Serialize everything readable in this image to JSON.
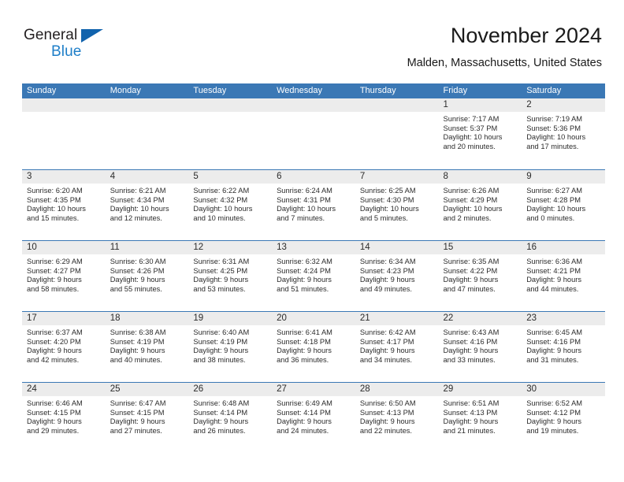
{
  "brand": {
    "word1": "General",
    "word2": "Blue",
    "flag_icon": "triangle-flag-icon",
    "color_dark": "#231f20",
    "color_blue": "#1e7ec8"
  },
  "header": {
    "title": "November 2024",
    "subtitle": "Malden, Massachusetts, United States"
  },
  "theme": {
    "header_blue": "#3b78b5",
    "daynum_band": "#ececec",
    "text": "#2b2b2b"
  },
  "calendar": {
    "day_headers": [
      "Sunday",
      "Monday",
      "Tuesday",
      "Wednesday",
      "Thursday",
      "Friday",
      "Saturday"
    ],
    "labels": {
      "sunrise": "Sunrise:",
      "sunset": "Sunset:",
      "daylight": "Daylight:"
    },
    "weeks": [
      [
        {
          "empty": true
        },
        {
          "empty": true
        },
        {
          "empty": true
        },
        {
          "empty": true
        },
        {
          "empty": true
        },
        {
          "day": "1",
          "sunrise": "Sunrise: 7:17 AM",
          "sunset": "Sunset: 5:37 PM",
          "daylight_line1": "Daylight: 10 hours",
          "daylight_line2": "and 20 minutes."
        },
        {
          "day": "2",
          "sunrise": "Sunrise: 7:19 AM",
          "sunset": "Sunset: 5:36 PM",
          "daylight_line1": "Daylight: 10 hours",
          "daylight_line2": "and 17 minutes."
        }
      ],
      [
        {
          "day": "3",
          "sunrise": "Sunrise: 6:20 AM",
          "sunset": "Sunset: 4:35 PM",
          "daylight_line1": "Daylight: 10 hours",
          "daylight_line2": "and 15 minutes."
        },
        {
          "day": "4",
          "sunrise": "Sunrise: 6:21 AM",
          "sunset": "Sunset: 4:34 PM",
          "daylight_line1": "Daylight: 10 hours",
          "daylight_line2": "and 12 minutes."
        },
        {
          "day": "5",
          "sunrise": "Sunrise: 6:22 AM",
          "sunset": "Sunset: 4:32 PM",
          "daylight_line1": "Daylight: 10 hours",
          "daylight_line2": "and 10 minutes."
        },
        {
          "day": "6",
          "sunrise": "Sunrise: 6:24 AM",
          "sunset": "Sunset: 4:31 PM",
          "daylight_line1": "Daylight: 10 hours",
          "daylight_line2": "and 7 minutes."
        },
        {
          "day": "7",
          "sunrise": "Sunrise: 6:25 AM",
          "sunset": "Sunset: 4:30 PM",
          "daylight_line1": "Daylight: 10 hours",
          "daylight_line2": "and 5 minutes."
        },
        {
          "day": "8",
          "sunrise": "Sunrise: 6:26 AM",
          "sunset": "Sunset: 4:29 PM",
          "daylight_line1": "Daylight: 10 hours",
          "daylight_line2": "and 2 minutes."
        },
        {
          "day": "9",
          "sunrise": "Sunrise: 6:27 AM",
          "sunset": "Sunset: 4:28 PM",
          "daylight_line1": "Daylight: 10 hours",
          "daylight_line2": "and 0 minutes."
        }
      ],
      [
        {
          "day": "10",
          "sunrise": "Sunrise: 6:29 AM",
          "sunset": "Sunset: 4:27 PM",
          "daylight_line1": "Daylight: 9 hours",
          "daylight_line2": "and 58 minutes."
        },
        {
          "day": "11",
          "sunrise": "Sunrise: 6:30 AM",
          "sunset": "Sunset: 4:26 PM",
          "daylight_line1": "Daylight: 9 hours",
          "daylight_line2": "and 55 minutes."
        },
        {
          "day": "12",
          "sunrise": "Sunrise: 6:31 AM",
          "sunset": "Sunset: 4:25 PM",
          "daylight_line1": "Daylight: 9 hours",
          "daylight_line2": "and 53 minutes."
        },
        {
          "day": "13",
          "sunrise": "Sunrise: 6:32 AM",
          "sunset": "Sunset: 4:24 PM",
          "daylight_line1": "Daylight: 9 hours",
          "daylight_line2": "and 51 minutes."
        },
        {
          "day": "14",
          "sunrise": "Sunrise: 6:34 AM",
          "sunset": "Sunset: 4:23 PM",
          "daylight_line1": "Daylight: 9 hours",
          "daylight_line2": "and 49 minutes."
        },
        {
          "day": "15",
          "sunrise": "Sunrise: 6:35 AM",
          "sunset": "Sunset: 4:22 PM",
          "daylight_line1": "Daylight: 9 hours",
          "daylight_line2": "and 47 minutes."
        },
        {
          "day": "16",
          "sunrise": "Sunrise: 6:36 AM",
          "sunset": "Sunset: 4:21 PM",
          "daylight_line1": "Daylight: 9 hours",
          "daylight_line2": "and 44 minutes."
        }
      ],
      [
        {
          "day": "17",
          "sunrise": "Sunrise: 6:37 AM",
          "sunset": "Sunset: 4:20 PM",
          "daylight_line1": "Daylight: 9 hours",
          "daylight_line2": "and 42 minutes."
        },
        {
          "day": "18",
          "sunrise": "Sunrise: 6:38 AM",
          "sunset": "Sunset: 4:19 PM",
          "daylight_line1": "Daylight: 9 hours",
          "daylight_line2": "and 40 minutes."
        },
        {
          "day": "19",
          "sunrise": "Sunrise: 6:40 AM",
          "sunset": "Sunset: 4:19 PM",
          "daylight_line1": "Daylight: 9 hours",
          "daylight_line2": "and 38 minutes."
        },
        {
          "day": "20",
          "sunrise": "Sunrise: 6:41 AM",
          "sunset": "Sunset: 4:18 PM",
          "daylight_line1": "Daylight: 9 hours",
          "daylight_line2": "and 36 minutes."
        },
        {
          "day": "21",
          "sunrise": "Sunrise: 6:42 AM",
          "sunset": "Sunset: 4:17 PM",
          "daylight_line1": "Daylight: 9 hours",
          "daylight_line2": "and 34 minutes."
        },
        {
          "day": "22",
          "sunrise": "Sunrise: 6:43 AM",
          "sunset": "Sunset: 4:16 PM",
          "daylight_line1": "Daylight: 9 hours",
          "daylight_line2": "and 33 minutes."
        },
        {
          "day": "23",
          "sunrise": "Sunrise: 6:45 AM",
          "sunset": "Sunset: 4:16 PM",
          "daylight_line1": "Daylight: 9 hours",
          "daylight_line2": "and 31 minutes."
        }
      ],
      [
        {
          "day": "24",
          "sunrise": "Sunrise: 6:46 AM",
          "sunset": "Sunset: 4:15 PM",
          "daylight_line1": "Daylight: 9 hours",
          "daylight_line2": "and 29 minutes."
        },
        {
          "day": "25",
          "sunrise": "Sunrise: 6:47 AM",
          "sunset": "Sunset: 4:15 PM",
          "daylight_line1": "Daylight: 9 hours",
          "daylight_line2": "and 27 minutes."
        },
        {
          "day": "26",
          "sunrise": "Sunrise: 6:48 AM",
          "sunset": "Sunset: 4:14 PM",
          "daylight_line1": "Daylight: 9 hours",
          "daylight_line2": "and 26 minutes."
        },
        {
          "day": "27",
          "sunrise": "Sunrise: 6:49 AM",
          "sunset": "Sunset: 4:14 PM",
          "daylight_line1": "Daylight: 9 hours",
          "daylight_line2": "and 24 minutes."
        },
        {
          "day": "28",
          "sunrise": "Sunrise: 6:50 AM",
          "sunset": "Sunset: 4:13 PM",
          "daylight_line1": "Daylight: 9 hours",
          "daylight_line2": "and 22 minutes."
        },
        {
          "day": "29",
          "sunrise": "Sunrise: 6:51 AM",
          "sunset": "Sunset: 4:13 PM",
          "daylight_line1": "Daylight: 9 hours",
          "daylight_line2": "and 21 minutes."
        },
        {
          "day": "30",
          "sunrise": "Sunrise: 6:52 AM",
          "sunset": "Sunset: 4:12 PM",
          "daylight_line1": "Daylight: 9 hours",
          "daylight_line2": "and 19 minutes."
        }
      ]
    ]
  }
}
